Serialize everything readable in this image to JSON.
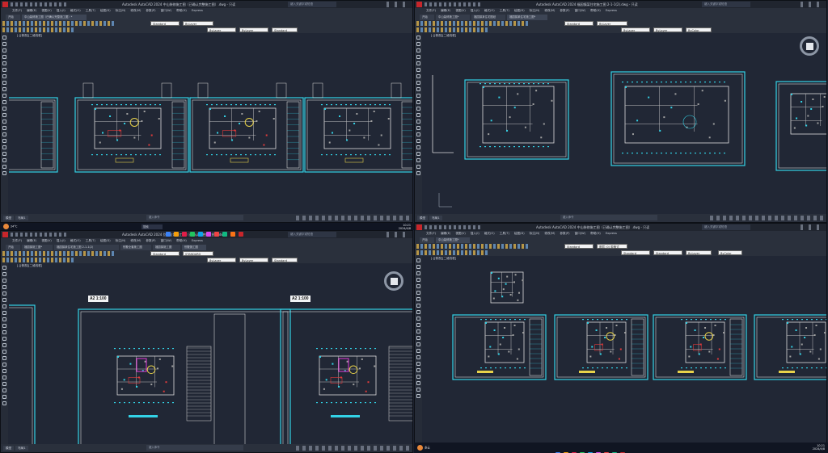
{
  "windows": [
    {
      "title": "Autodesk AutoCAD 2024   中山装修施工图（已确认完整施工图）.dwg - 只读",
      "search": "键入关键字或短语",
      "menus": [
        "文件(F)",
        "编辑(E)",
        "视图(V)",
        "插入(I)",
        "格式(O)",
        "工具(T)",
        "绘图(D)",
        "标注(N)",
        "修改(M)",
        "参数(P)",
        "窗口(W)",
        "帮助(H)",
        "Express"
      ],
      "tabs": [
        "开始",
        "中山装修施工图（已确认完整施工图）*"
      ],
      "dropdowns": [
        "Standard",
        "ByLayer",
        "ByLayer",
        "ByLayer",
        "Standard"
      ],
      "viewport_label": "[-][俯视][二维线框]",
      "layout_tabs": [
        "模型",
        "布局1"
      ],
      "command_placeholder": "键入命令"
    },
    {
      "title": "Autodesk AutoCAD 2024   福园镇某住宅施工图 2-1-1(2).dwg - 只读",
      "search": "键入关键字或短语",
      "menus": [
        "文件(F)",
        "编辑(E)",
        "视图(V)",
        "插入(I)",
        "格式(O)",
        "工具(T)",
        "绘图(D)",
        "标注(N)",
        "修改(M)",
        "参数(P)",
        "窗口(W)",
        "帮助(H)",
        "Express"
      ],
      "tabs": [
        "开始",
        "中山装修施工图*",
        "福园镇某住宅图纸",
        "福园镇某住宅施工图*"
      ],
      "dropdowns": [
        "Standard",
        "ByLayer",
        "ByLayer",
        "ByLayer",
        "ByColor"
      ],
      "viewport_label": "[-][俯视][二维线框]",
      "layout_tabs": [
        "模型",
        "布局1"
      ],
      "command_placeholder": "键入命令"
    },
    {
      "title": "Autodesk AutoCAD 2024   别墅全套施工图（已确认完整施工图）.dwg",
      "search": "键入关键字或短语",
      "menus": [
        "文件(F)",
        "编辑(E)",
        "视图(V)",
        "插入(I)",
        "格式(O)",
        "工具(T)",
        "绘图(D)",
        "标注(N)",
        "修改(M)",
        "参数(P)",
        "窗口(W)",
        "帮助(H)",
        "Express"
      ],
      "tabs": [
        "开始",
        "福园镇施工图*",
        "福园镇某住宅施工图 2-1-1(2)",
        "别墅全套施工图",
        "福园镇施工图",
        "别墅施工图"
      ],
      "dropdowns": [
        "Standard",
        "STANDARD",
        "ByLayer",
        "ByLayer",
        "Standard"
      ],
      "viewport_label": "[-][俯视][二维线框]",
      "layout_tabs": [
        "模型",
        "布局1"
      ],
      "command_placeholder": "键入命令",
      "sheet_labels": [
        "A2 1:100",
        "A2 1:100"
      ]
    },
    {
      "title": "Autodesk AutoCAD 2024   中山装修施工图（已确认完整施工图）.dwg - 只读",
      "search": "键入关键字或短语",
      "menus": [
        "文件(F)",
        "编辑(E)",
        "视图(V)",
        "插入(I)",
        "格式(O)",
        "工具(T)",
        "绘图(D)",
        "标注(N)",
        "修改(M)",
        "参数(P)",
        "窗口(W)",
        "帮助(H)",
        "Express"
      ],
      "tabs": [
        "开始",
        "中山装修施工图*"
      ],
      "dropdowns": [
        "Standard",
        "图层 (0) 带格式",
        "Standard",
        "Standard",
        "ByLayer",
        "ByColor"
      ],
      "viewport_label": "[-][俯视][二维线框]",
      "layout_tabs": [
        "模型",
        "布局1"
      ],
      "command_placeholder": "键入命令"
    }
  ],
  "taskbar_mid": {
    "search": "搜索",
    "time": "10:21",
    "date": "2024/4/8"
  },
  "taskbar_bottom": {
    "time": "10:21",
    "date": "2024/4/8"
  },
  "weather": {
    "temp": "24°C",
    "desc": "多云"
  }
}
